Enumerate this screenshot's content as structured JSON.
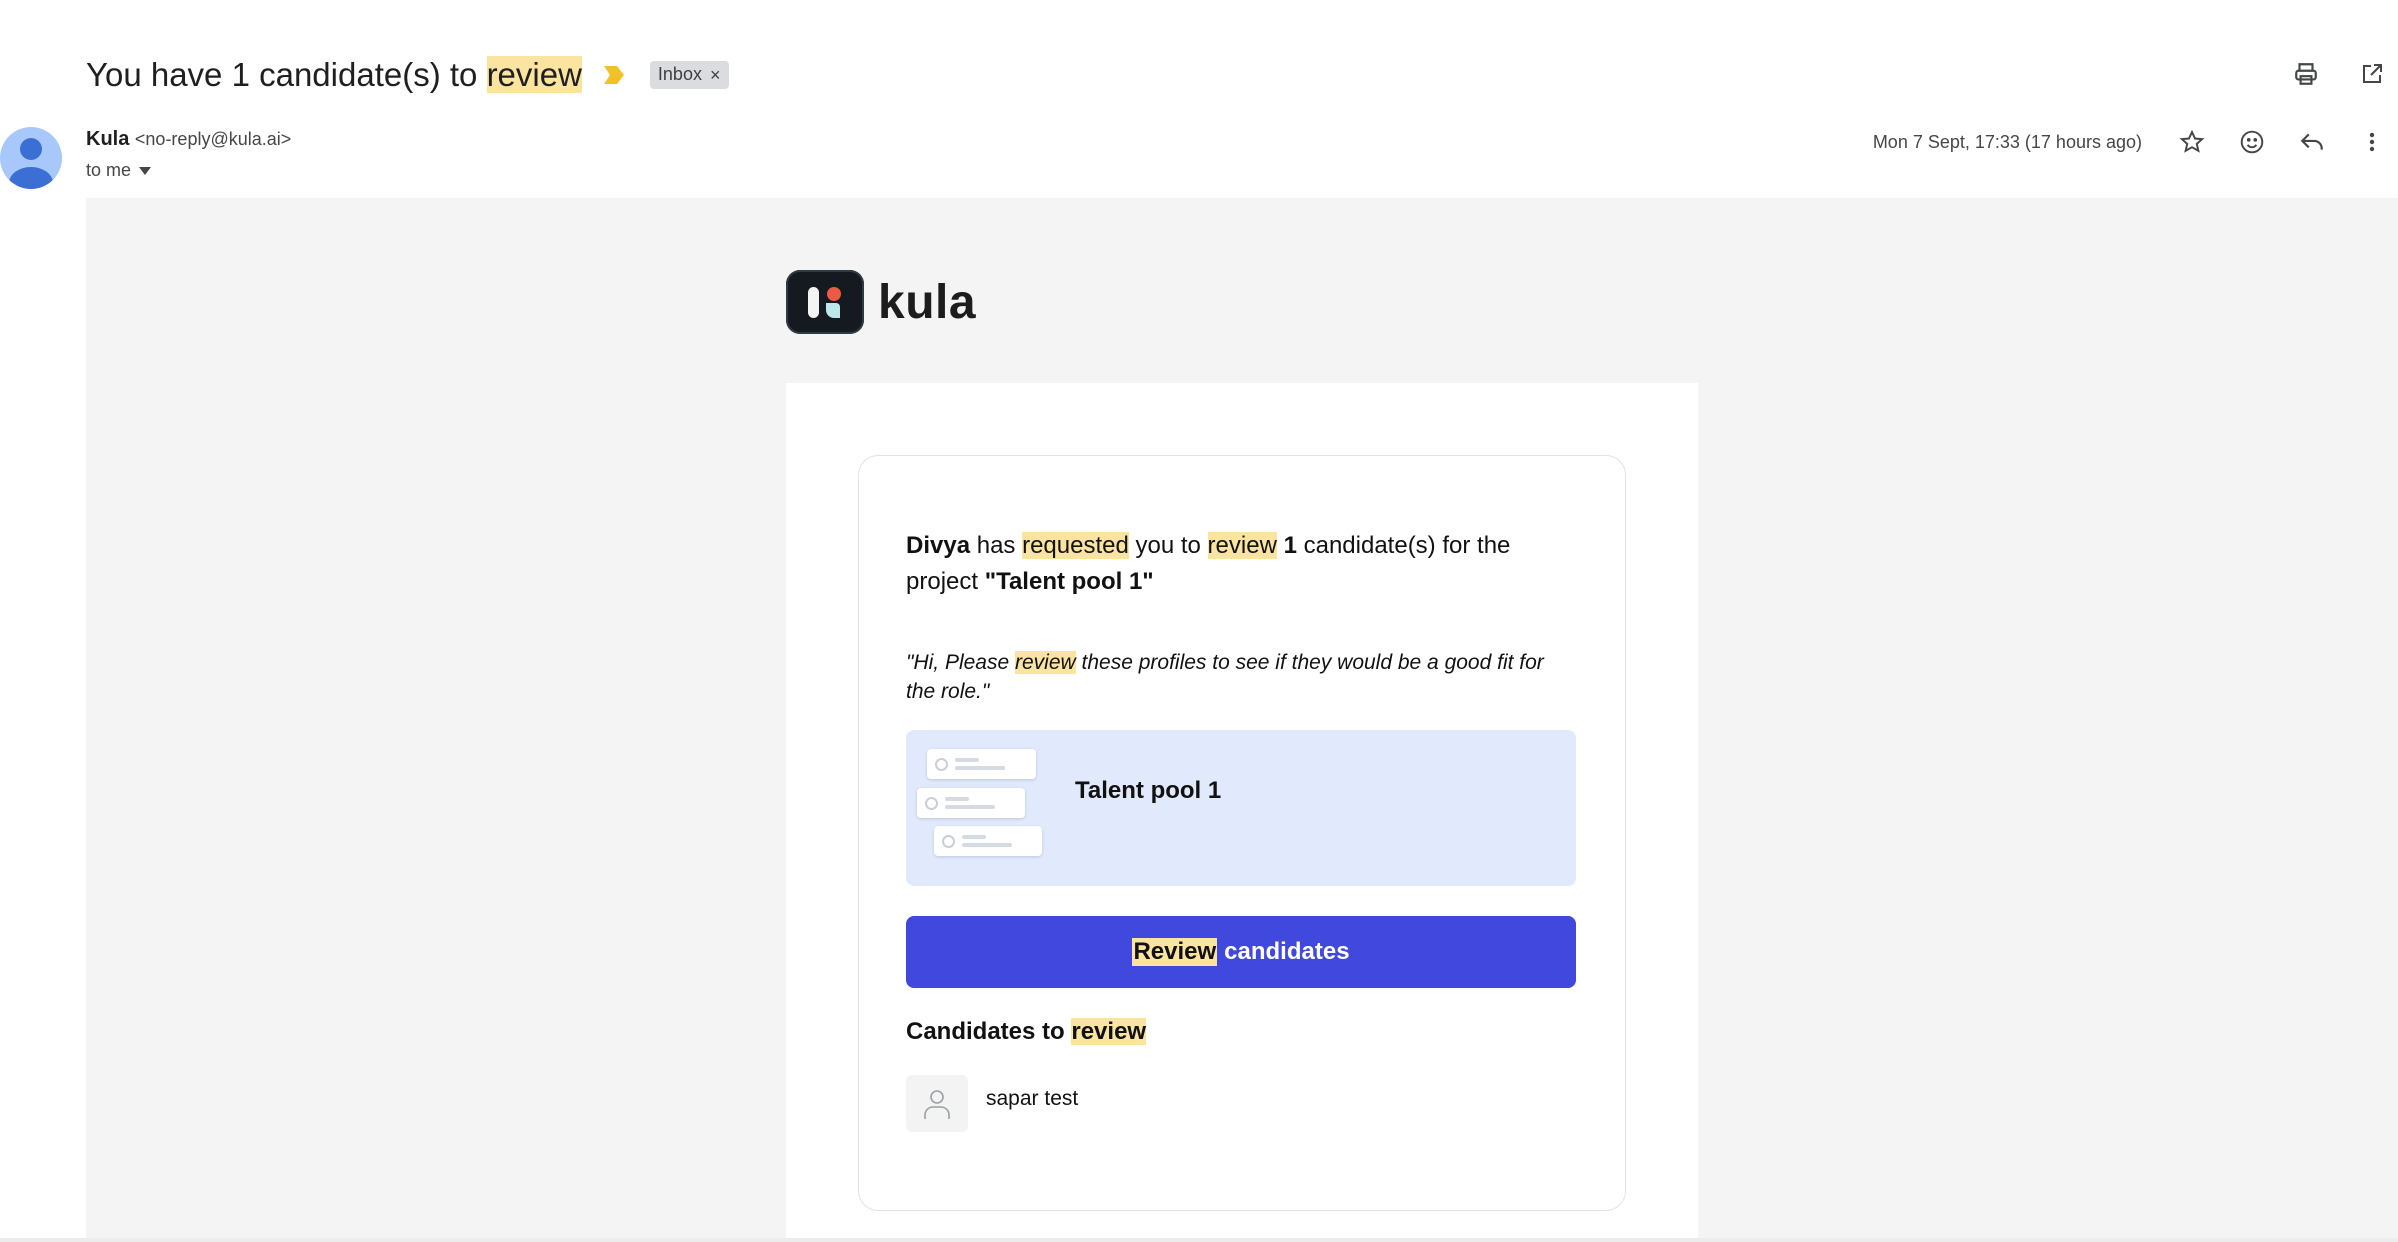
{
  "subject": {
    "prefix": "You have 1 candidate(s) to ",
    "highlight": "review"
  },
  "labels": {
    "inbox": "Inbox",
    "remove": "×"
  },
  "sender": {
    "name": "Kula",
    "email": "<no-reply@kula.ai>",
    "to": "to me"
  },
  "date": "Mon 7 Sept, 17:33 (17 hours ago)",
  "icons": [
    "print-icon",
    "open-in-new-window-icon",
    "star-icon",
    "emoji-reaction-icon",
    "reply-icon",
    "more-options-icon",
    "importance-marker-icon",
    "chevron-down-icon"
  ],
  "email": {
    "logo_text": "kula",
    "intro": {
      "requester": "Divya",
      "t1": " has ",
      "requested": "requested",
      "t2": " you to ",
      "review": "review",
      "t3": " ",
      "count": "1",
      "t4": " candidate(s) for the project ",
      "project": "\"Talent pool 1\""
    },
    "quote": {
      "pre": "\"Hi, Please ",
      "review": "review",
      "post": " these profiles to see if they would be a good fit for the role.\""
    },
    "project_card_title": "Talent pool 1",
    "cta": {
      "highlight": "Review",
      "rest": "candidates"
    },
    "candidates_heading": {
      "pre": "Candidates to ",
      "highlight": "review"
    },
    "candidates": [
      {
        "name": "sapar test"
      }
    ]
  },
  "colors": {
    "highlight": "#fbe3a0",
    "cta": "#4148de",
    "project_card": "#e1eafc",
    "email_bg": "#f4f4f4"
  }
}
